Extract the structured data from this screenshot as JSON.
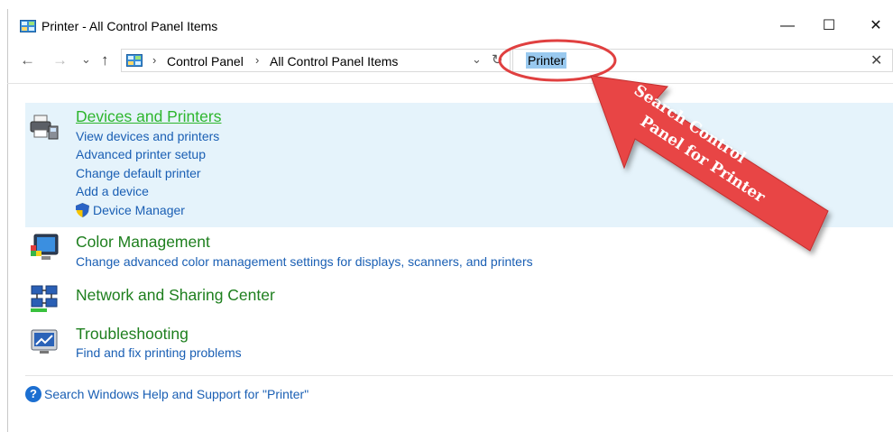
{
  "window": {
    "title": "Printer - All Control Panel Items",
    "minimize_glyph": "—",
    "maximize_glyph": "☐",
    "close_glyph": "✕"
  },
  "nav": {
    "back_glyph": "←",
    "forward_glyph": "→",
    "recent_glyph": "⌄",
    "up_glyph": "↑"
  },
  "address": {
    "crumbs": [
      "Control Panel",
      "All Control Panel Items"
    ],
    "separator": "›",
    "dropdown_glyph": "⌄",
    "refresh_glyph": "↻"
  },
  "search": {
    "value": "Printer",
    "clear_glyph": "✕"
  },
  "results": [
    {
      "title": "Devices and Printers",
      "icon": "printer-icon",
      "links": [
        "View devices and printers",
        "Advanced printer setup",
        "Change default printer",
        "Add a device",
        "Device Manager"
      ]
    },
    {
      "title": "Color Management",
      "icon": "color-management-icon",
      "links": [
        "Change advanced color management settings for displays, scanners, and printers"
      ]
    },
    {
      "title": "Network and Sharing Center",
      "icon": "network-icon",
      "links": []
    },
    {
      "title": "Troubleshooting",
      "icon": "troubleshooting-icon",
      "links": [
        "Find and fix printing problems"
      ]
    }
  ],
  "help": {
    "icon_glyph": "?",
    "text": "Search Windows Help and Support for \"Printer\""
  },
  "annotation": {
    "line1": "Search Control",
    "line2": "Panel for Printer",
    "color": "#e84545"
  }
}
